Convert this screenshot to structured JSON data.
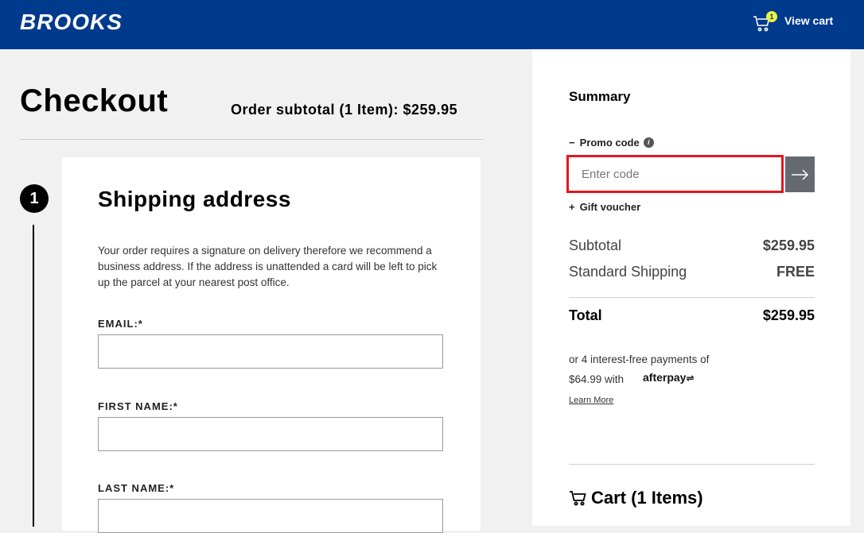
{
  "header": {
    "logo": "BROOKS",
    "cart_count": "1",
    "view_cart": "View cart",
    "background": "#003a8c"
  },
  "checkout": {
    "title": "Checkout",
    "order_subtotal": "Order subtotal (1 Item): $259.95",
    "step_number": "1",
    "shipping": {
      "title": "Shipping address",
      "note": "Your order requires a signature on delivery therefore we recommend a business address. If the address is unattended a card will be left to pick up the parcel at your nearest post office.",
      "fields": [
        {
          "label": "EMAIL:*",
          "value": ""
        },
        {
          "label": "FIRST NAME:*",
          "value": ""
        },
        {
          "label": "LAST NAME:*",
          "value": ""
        }
      ]
    }
  },
  "summary": {
    "title": "Summary",
    "promo_toggle": "Promo code",
    "promo_placeholder": "Enter code",
    "gift_toggle": "Gift voucher",
    "subtotal_label": "Subtotal",
    "subtotal_value": "$259.95",
    "shipping_label": "Standard Shipping",
    "shipping_value": "FREE",
    "total_label": "Total",
    "total_value": "$259.95",
    "afterpay_line1": "or 4 interest-free payments of",
    "afterpay_line2": "$64.99 with",
    "afterpay_logo": "afterpay",
    "learn_more": "Learn More",
    "cart_heading": "Cart (1 Items)",
    "highlight_color": "#e2171f"
  }
}
